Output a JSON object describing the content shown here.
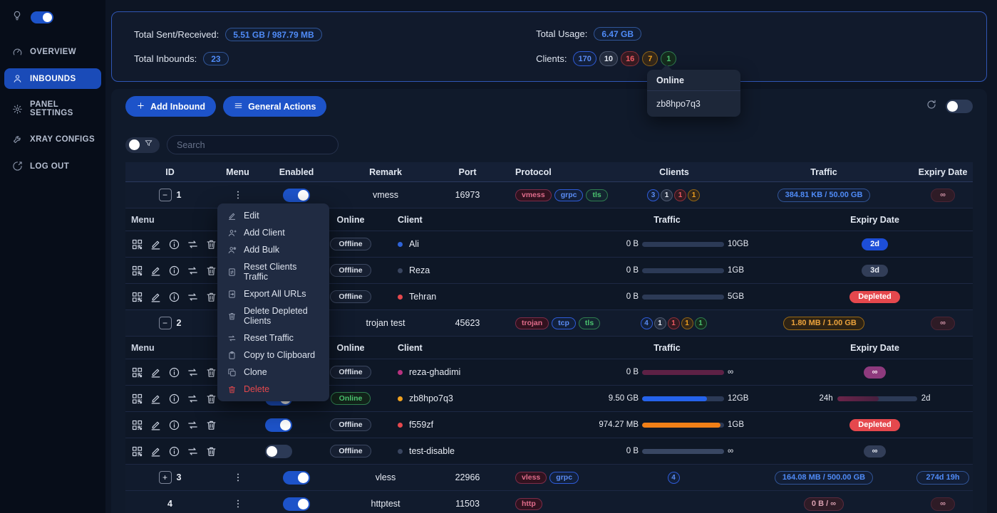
{
  "sidebar": {
    "theme": {
      "icon": "bulb-icon",
      "toggle_on": true
    },
    "items": [
      {
        "label": "OVERVIEW",
        "icon": "gauge-icon",
        "active": false
      },
      {
        "label": "INBOUNDS",
        "icon": "user-icon",
        "active": true
      },
      {
        "label": "PANEL SETTINGS",
        "icon": "gear-icon",
        "active": false
      },
      {
        "label": "XRAY CONFIGS",
        "icon": "wrench-icon",
        "active": false
      },
      {
        "label": "LOG OUT",
        "icon": "logout-icon",
        "active": false
      }
    ]
  },
  "stats": {
    "sent_received_label": "Total Sent/Received:",
    "sent_received_value": "5.51 GB / 987.79 MB",
    "inbounds_label": "Total Inbounds:",
    "inbounds_value": "23",
    "usage_label": "Total Usage:",
    "usage_value": "6.47 GB",
    "clients_label": "Clients:",
    "client_badges": [
      {
        "value": "170",
        "color": "blue"
      },
      {
        "value": "10",
        "color": "gray"
      },
      {
        "value": "16",
        "color": "red"
      },
      {
        "value": "7",
        "color": "orange"
      },
      {
        "value": "1",
        "color": "green"
      }
    ]
  },
  "online_popover": {
    "title": "Online",
    "clients": [
      "zb8hpo7q3"
    ]
  },
  "toolbar": {
    "add_inbound": "Add Inbound",
    "general_actions": "General Actions",
    "refresh_toggle_on": false
  },
  "search": {
    "placeholder": "Search",
    "filter_toggle_on": false
  },
  "table": {
    "headers": [
      "ID",
      "Menu",
      "Enabled",
      "Remark",
      "Port",
      "Protocol",
      "Clients",
      "Traffic",
      "Expiry Date"
    ],
    "sub_headers": {
      "menu": "Menu",
      "online": "Online",
      "client": "Client",
      "traffic": "Traffic",
      "expiry": "Expiry Date"
    }
  },
  "context_menu": {
    "items": [
      {
        "label": "Edit",
        "icon": "pencil-icon",
        "danger": false
      },
      {
        "label": "Add Client",
        "icon": "user-add-icon",
        "danger": false
      },
      {
        "label": "Add Bulk",
        "icon": "user-bulk-icon",
        "danger": false
      },
      {
        "label": "Reset Clients Traffic",
        "icon": "doc-reset-icon",
        "danger": false
      },
      {
        "label": "Export All URLs",
        "icon": "export-icon",
        "danger": false
      },
      {
        "label": "Delete Depleted Clients",
        "icon": "trash-icon",
        "danger": false
      },
      {
        "label": "Reset Traffic",
        "icon": "repeat-icon",
        "danger": false
      },
      {
        "label": "Copy to Clipboard",
        "icon": "clipboard-icon",
        "danger": false
      },
      {
        "label": "Clone",
        "icon": "clone-icon",
        "danger": false
      },
      {
        "label": "Delete",
        "icon": "trash-icon",
        "danger": true
      }
    ]
  },
  "colors": {
    "accent": "#1d53c9",
    "online_green": "#4cc470",
    "danger_red": "#e5484d",
    "warn_orange": "#f0a11f"
  },
  "rows": [
    {
      "type": "inbound",
      "id": "1",
      "expander": "minus",
      "enabled": true,
      "remark": "vmess",
      "port": "16973",
      "tags": [
        {
          "label": "vmess",
          "color": "magenta"
        },
        {
          "label": "grpc",
          "color": "blue"
        },
        {
          "label": "tls",
          "color": "green"
        }
      ],
      "client_badges": [
        {
          "value": "3",
          "color": "blue"
        },
        {
          "value": "1",
          "color": "gray"
        },
        {
          "value": "1",
          "color": "red"
        },
        {
          "value": "1",
          "color": "orange"
        }
      ],
      "traffic": {
        "text": "384.81 KB / 50.00 GB",
        "color": "blue"
      },
      "expiry": {
        "style": "maroon",
        "text": "∞"
      }
    },
    {
      "type": "subheader"
    },
    {
      "type": "client",
      "enabled": true,
      "status": "Offline",
      "dot_color": "#2e63d8",
      "name": "Ali",
      "used": "0 B",
      "total": "10GB",
      "bar": {
        "pct": 0,
        "color": "none"
      },
      "expiry": {
        "style": "blue-solid",
        "text": "2d"
      }
    },
    {
      "type": "client",
      "enabled": true,
      "status": "Offline",
      "dot_color": "#39455f",
      "name": "Reza",
      "used": "0 B",
      "total": "1GB",
      "bar": {
        "pct": 0,
        "color": "none"
      },
      "expiry": {
        "style": "slate",
        "text": "3d"
      }
    },
    {
      "type": "client",
      "enabled": true,
      "status": "Offline",
      "dot_color": "#e5484d",
      "name": "Tehran",
      "used": "0 B",
      "total": "5GB",
      "bar": {
        "pct": 0,
        "color": "none"
      },
      "expiry": {
        "style": "red-solid",
        "text": "Depleted"
      }
    },
    {
      "type": "inbound",
      "id": "2",
      "expander": "minus",
      "enabled": true,
      "remark": "trojan test",
      "port": "45623",
      "tags": [
        {
          "label": "trojan",
          "color": "magenta"
        },
        {
          "label": "tcp",
          "color": "blue"
        },
        {
          "label": "tls",
          "color": "green"
        }
      ],
      "client_badges": [
        {
          "value": "4",
          "color": "blue"
        },
        {
          "value": "1",
          "color": "gray"
        },
        {
          "value": "1",
          "color": "red"
        },
        {
          "value": "1",
          "color": "orange"
        },
        {
          "value": "1",
          "color": "green"
        }
      ],
      "traffic": {
        "text": "1.80 MB / 1.00 GB",
        "color": "orange"
      },
      "expiry": {
        "style": "maroon",
        "text": "∞"
      }
    },
    {
      "type": "subheader"
    },
    {
      "type": "client",
      "enabled": true,
      "status": "Offline",
      "dot_color": "#b83280",
      "name": "reza-ghadimi",
      "used": "0 B",
      "total": "∞",
      "bar": {
        "pct": 100,
        "color": "#5e2145"
      },
      "expiry": {
        "style": "purple-solid",
        "text": "∞"
      }
    },
    {
      "type": "client",
      "enabled": true,
      "status": "Online",
      "dot_color": "#f0a11f",
      "name": "zb8hpo7q3",
      "used": "9.50 GB",
      "total": "12GB",
      "bar": {
        "pct": 79,
        "color": "#2563eb"
      },
      "expiry": {
        "style": "range",
        "from": "24h",
        "to": "2d",
        "pct": 52
      }
    },
    {
      "type": "client",
      "enabled": true,
      "status": "Offline",
      "dot_color": "#e5484d",
      "name": "f559zf",
      "used": "974.27 MB",
      "total": "1GB",
      "bar": {
        "pct": 96,
        "color": "#f07f17"
      },
      "expiry": {
        "style": "red-solid",
        "text": "Depleted"
      }
    },
    {
      "type": "client",
      "enabled": false,
      "status": "Offline",
      "dot_color": "#39455f",
      "name": "test-disable",
      "used": "0 B",
      "total": "∞",
      "bar": {
        "pct": 100,
        "color": "#394763"
      },
      "expiry": {
        "style": "slate",
        "text": "∞"
      }
    },
    {
      "type": "inbound",
      "id": "3",
      "expander": "plus",
      "enabled": true,
      "remark": "vless",
      "port": "22966",
      "tags": [
        {
          "label": "vless",
          "color": "magenta"
        },
        {
          "label": "grpc",
          "color": "blue"
        }
      ],
      "client_badges": [
        {
          "value": "4",
          "color": "blue"
        }
      ],
      "traffic": {
        "text": "164.08 MB / 500.00 GB",
        "color": "blue"
      },
      "expiry": {
        "style": "blue-outline",
        "text": "274d 19h"
      }
    },
    {
      "type": "inbound",
      "id": "4",
      "expander": "none",
      "enabled": true,
      "remark": "httptest",
      "port": "11503",
      "tags": [
        {
          "label": "http",
          "color": "magenta"
        }
      ],
      "client_badges": [],
      "traffic": {
        "text": "0 B / ∞",
        "color": "maroon"
      },
      "expiry": {
        "style": "maroon",
        "text": "∞"
      }
    }
  ]
}
